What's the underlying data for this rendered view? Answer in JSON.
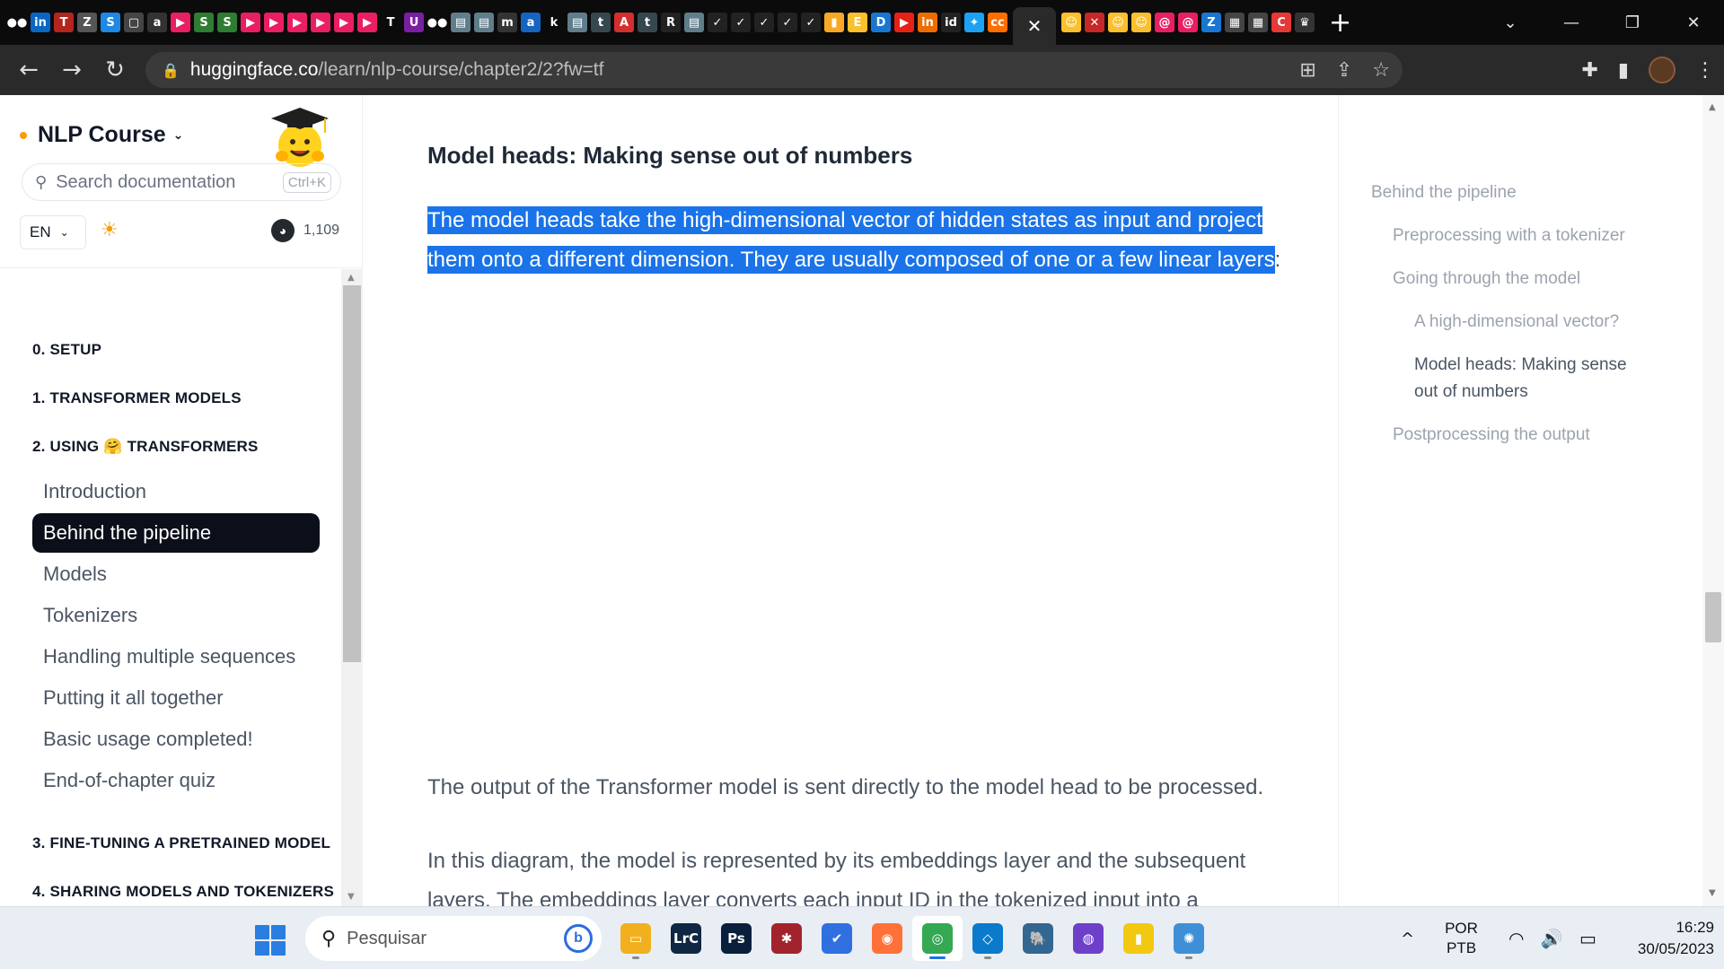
{
  "browser": {
    "tabs": {
      "favicons": [
        {
          "icon": "dots-icon",
          "color": "#0b0b0b",
          "glyph": "●●"
        },
        {
          "icon": "linkedin-icon",
          "color": "#0a66c2",
          "glyph": "in"
        },
        {
          "icon": "t-red-icon",
          "color": "#b3261e",
          "glyph": "T"
        },
        {
          "icon": "z-icon",
          "color": "#555",
          "glyph": "Z"
        },
        {
          "icon": "s-icon",
          "color": "#1e88e5",
          "glyph": "S"
        },
        {
          "icon": "puzzle-icon",
          "color": "#444",
          "glyph": "▢"
        },
        {
          "icon": "a-icon",
          "color": "#333",
          "glyph": "a"
        },
        {
          "icon": "play-pink-icon",
          "color": "#e91e63",
          "glyph": "▶"
        },
        {
          "icon": "s-green-icon",
          "color": "#2e7d32",
          "glyph": "S"
        },
        {
          "icon": "s-green-icon",
          "color": "#2e7d32",
          "glyph": "S"
        },
        {
          "icon": "play-pink-icon",
          "color": "#e91e63",
          "glyph": "▶"
        },
        {
          "icon": "play-pink-icon",
          "color": "#e91e63",
          "glyph": "▶"
        },
        {
          "icon": "play-pink-icon",
          "color": "#e91e63",
          "glyph": "▶"
        },
        {
          "icon": "play-pink-icon",
          "color": "#e91e63",
          "glyph": "▶"
        },
        {
          "icon": "play-pink-icon",
          "color": "#e91e63",
          "glyph": "▶"
        },
        {
          "icon": "play-pink-icon",
          "color": "#e91e63",
          "glyph": "▶"
        },
        {
          "icon": "t-white-icon",
          "color": "#0b0b0b",
          "glyph": "T"
        },
        {
          "icon": "u-icon",
          "color": "#7b1fa2",
          "glyph": "U"
        },
        {
          "icon": "dots-icon",
          "color": "#0b0b0b",
          "glyph": "●●"
        },
        {
          "icon": "doc-icon",
          "color": "#607d8b",
          "glyph": "▤"
        },
        {
          "icon": "doc-icon",
          "color": "#607d8b",
          "glyph": "▤"
        },
        {
          "icon": "m-icon",
          "color": "#333",
          "glyph": "m"
        },
        {
          "icon": "a-circle-icon",
          "color": "#1565c0",
          "glyph": "a"
        },
        {
          "icon": "k-icon",
          "color": "#0b0b0b",
          "glyph": "k"
        },
        {
          "icon": "doc-icon",
          "color": "#607d8b",
          "glyph": "▤"
        },
        {
          "icon": "tds-icon",
          "color": "#37474f",
          "glyph": "t"
        },
        {
          "icon": "pdf-icon",
          "color": "#d32f2f",
          "glyph": "A"
        },
        {
          "icon": "tds-icon",
          "color": "#37474f",
          "glyph": "t"
        },
        {
          "icon": "r-icon",
          "color": "#222",
          "glyph": "R"
        },
        {
          "icon": "doc-icon",
          "color": "#607d8b",
          "glyph": "▤"
        },
        {
          "icon": "check-icon",
          "color": "#222",
          "glyph": "✓"
        },
        {
          "icon": "check-icon",
          "color": "#222",
          "glyph": "✓"
        },
        {
          "icon": "check-icon",
          "color": "#222",
          "glyph": "✓"
        },
        {
          "icon": "check-icon",
          "color": "#222",
          "glyph": "✓"
        },
        {
          "icon": "check-icon",
          "color": "#222",
          "glyph": "✓"
        },
        {
          "icon": "bookmark-icon",
          "color": "#f9a825",
          "glyph": "▮"
        },
        {
          "icon": "e-icon",
          "color": "#fbc02d",
          "glyph": "E"
        },
        {
          "icon": "dtn-icon",
          "color": "#1976d2",
          "glyph": "D"
        },
        {
          "icon": "youtube-icon",
          "color": "#e62117",
          "glyph": "▶"
        },
        {
          "icon": "in-orange-icon",
          "color": "#ef6c00",
          "glyph": "in"
        },
        {
          "icon": "id-icon",
          "color": "#222",
          "glyph": "id"
        },
        {
          "icon": "bird-icon",
          "color": "#1da1f2",
          "glyph": "✦"
        },
        {
          "icon": "cc-icon",
          "color": "#ff6f00",
          "glyph": "cc"
        }
      ],
      "active_close": "✕",
      "favicons_right": [
        {
          "icon": "emoji-icon",
          "color": "#fbc02d",
          "glyph": "☺"
        },
        {
          "icon": "x-icon",
          "color": "#c62828",
          "glyph": "✕"
        },
        {
          "icon": "emoji-icon",
          "color": "#fbc02d",
          "glyph": "☺"
        },
        {
          "icon": "emoji-icon",
          "color": "#fbc02d",
          "glyph": "☺"
        },
        {
          "icon": "spiral-icon",
          "color": "#e91e63",
          "glyph": "@"
        },
        {
          "icon": "spiral-icon",
          "color": "#e91e63",
          "glyph": "@"
        },
        {
          "icon": "z-blue-icon",
          "color": "#1976d2",
          "glyph": "Z"
        },
        {
          "icon": "grid-icon",
          "color": "#444",
          "glyph": "▦"
        },
        {
          "icon": "grid-icon",
          "color": "#444",
          "glyph": "▦"
        },
        {
          "icon": "c-icon",
          "color": "#e53935",
          "glyph": "C"
        },
        {
          "icon": "crown-icon",
          "color": "#333",
          "glyph": "♛"
        }
      ],
      "new_tab": "+"
    },
    "window_controls": {
      "dropdown": "⌄",
      "minimize": "—",
      "restore": "❐",
      "close": "✕"
    },
    "nav": {
      "back": "←",
      "forward": "→",
      "reload": "↻"
    },
    "address": {
      "lock": "🔒",
      "host": "huggingface.co",
      "path": "/learn/nlp-course/chapter2/2?fw=tf"
    },
    "omni_icons": {
      "translate": "⊞",
      "share": "⇪",
      "bookmark": "☆"
    },
    "toolbar_icons": {
      "extensions": "✚",
      "sidepanel": "▮"
    }
  },
  "sidebar": {
    "course_title": "NLP Course",
    "search_placeholder": "Search documentation",
    "search_shortcut": "Ctrl+K",
    "language": "EN",
    "github_stars": "1,109",
    "chapters": [
      {
        "label": "0. SETUP"
      },
      {
        "label": "1. TRANSFORMER MODELS"
      },
      {
        "label_prefix": "2. USING",
        "emoji": "🤗",
        "label_suffix": "TRANSFORMERS"
      },
      {
        "label": "3. FINE-TUNING A PRETRAINED MODEL"
      },
      {
        "label": "4. SHARING MODELS AND TOKENIZERS"
      }
    ],
    "items": [
      {
        "label": "Introduction"
      },
      {
        "label": "Behind the pipeline"
      },
      {
        "label": "Models"
      },
      {
        "label": "Tokenizers"
      },
      {
        "label": "Handling multiple sequences"
      },
      {
        "label": "Putting it all together"
      },
      {
        "label": "Basic usage completed!"
      },
      {
        "label": "End-of-chapter quiz"
      }
    ],
    "active_item": "Behind the pipeline"
  },
  "content": {
    "heading": "Model heads: Making sense out of numbers",
    "highlight_line1": "The model heads take the high-dimensional vector of hidden states as input and project",
    "highlight_line2": "them onto a different dimension. They are usually composed of one or a few linear layers",
    "highlight_trailing": ":",
    "para_output": "The output of the Transformer model is sent directly to the model head to be processed.",
    "para_diagram_line1": "In this diagram, the model is represented by its embeddings layer and the subsequent",
    "para_diagram_line2": "layers. The embeddings layer converts each input ID in the tokenized input into a vector"
  },
  "toc": {
    "items": [
      {
        "label": "Behind the pipeline"
      },
      {
        "label": "Preprocessing with a tokenizer"
      },
      {
        "label": "Going through the model"
      },
      {
        "label": "A high-dimensional vector?"
      },
      {
        "label": "Model heads: Making sense out of numbers"
      },
      {
        "label": "Postprocessing the output"
      }
    ],
    "current": "Model heads: Making sense out of numbers"
  },
  "taskbar": {
    "search_placeholder": "Pesquisar",
    "apps": [
      {
        "name": "file-explorer",
        "glyph": "▭",
        "color": "#f2b01e"
      },
      {
        "name": "lightroom-classic",
        "glyph": "LrC",
        "color": "#0f2742"
      },
      {
        "name": "photoshop",
        "glyph": "Ps",
        "color": "#0a1f3c"
      },
      {
        "name": "mendeley",
        "glyph": "✱",
        "color": "#a3232d"
      },
      {
        "name": "todo",
        "glyph": "✔",
        "color": "#2f6fe0"
      },
      {
        "name": "firefox",
        "glyph": "◉",
        "color": "#ff7139"
      },
      {
        "name": "chrome",
        "glyph": "◎",
        "color": "#34a853"
      },
      {
        "name": "vscode",
        "glyph": "◇",
        "color": "#0a7acc"
      },
      {
        "name": "postgresql",
        "glyph": "🐘",
        "color": "#336791"
      },
      {
        "name": "github-desktop",
        "glyph": "◍",
        "color": "#6e40c9"
      },
      {
        "name": "power-bi",
        "glyph": "▮",
        "color": "#f2c811"
      },
      {
        "name": "app-globe",
        "glyph": "✺",
        "color": "#3f8fd6"
      }
    ],
    "active_app": "chrome",
    "tray_chevron": "^",
    "lang_top": "POR",
    "lang_bottom": "PTB",
    "tray_icons": "◠ 🔊 ▭",
    "time": "16:29",
    "date": "30/05/2023"
  }
}
